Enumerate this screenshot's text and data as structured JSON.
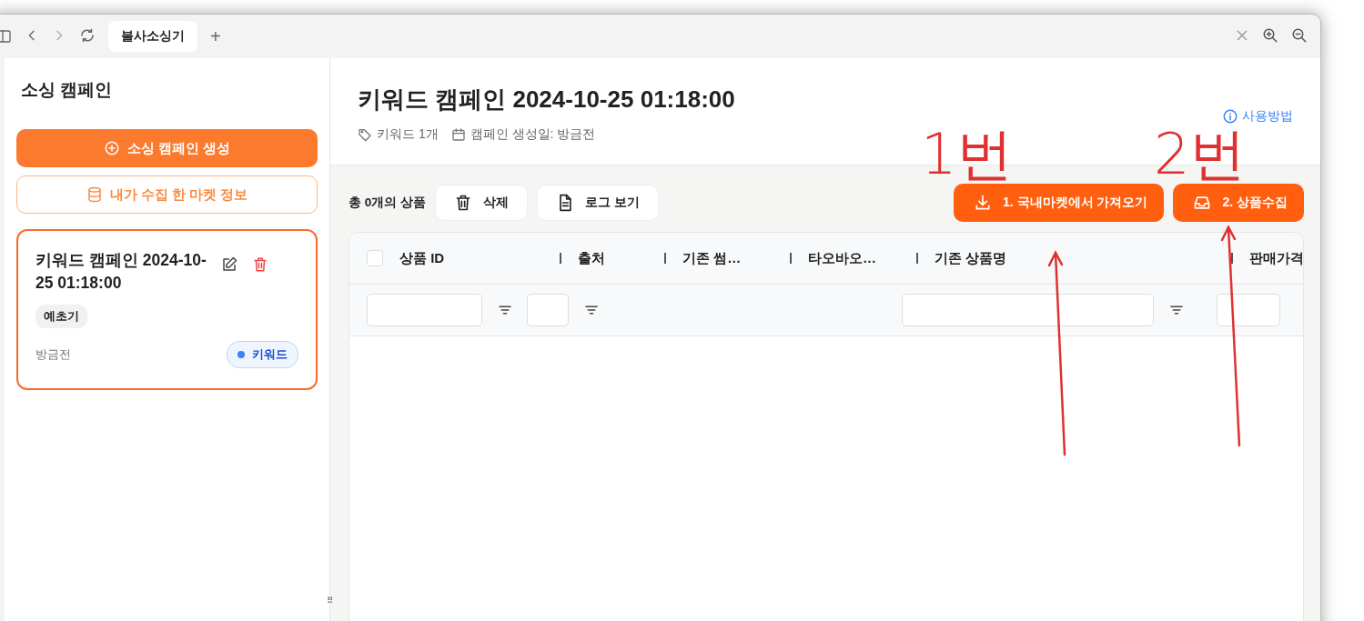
{
  "browser": {
    "tabs": [
      {
        "title": "불사소싱기",
        "selected": true
      }
    ],
    "new_tab": "+"
  },
  "sidebar": {
    "title": "소싱 캠페인",
    "create_button": "소싱 캠페인 생성",
    "market_button": "내가 수집 한 마켓 정보",
    "campaigns": [
      {
        "title": "키워드 캠페인 2024-10-25 01:18:00",
        "tag": "예초기",
        "time": "방금전",
        "badge": {
          "label": "키워드",
          "color": "#3b82f6"
        },
        "selected": true
      }
    ]
  },
  "main": {
    "title": "키워드 캠페인 2024-10-25 01:18:00",
    "meta": [
      {
        "kind": "tag",
        "text": "키워드 1개"
      },
      {
        "kind": "calendar",
        "text": "캠페인 생성일: 방금전"
      }
    ],
    "help_link": "사용방법",
    "product_count": "총 0개의 상품",
    "actions": [
      {
        "kind": "trash",
        "label": "삭제"
      },
      {
        "kind": "document",
        "label": "로그 보기"
      }
    ],
    "primary_actions": [
      {
        "kind": "download",
        "label": "1. 국내마켓에서 가져오기"
      },
      {
        "kind": "inbox",
        "label": "2. 상품수집"
      }
    ],
    "table": {
      "select_all": {
        "checked": false
      },
      "columns": [
        {
          "label": "상품 ID",
          "filter": true
        },
        {
          "label": "출처",
          "filter": true
        },
        {
          "label": "기존 썸…",
          "filter": false
        },
        {
          "label": "타오바오…",
          "filter": false
        },
        {
          "label": "기존 상품명",
          "filter": true
        },
        {
          "label": "판매가격",
          "filter": true
        }
      ]
    }
  },
  "annotations": [
    {
      "text": "1번"
    },
    {
      "text": "2번"
    }
  ],
  "resize_handle": "⠿"
}
